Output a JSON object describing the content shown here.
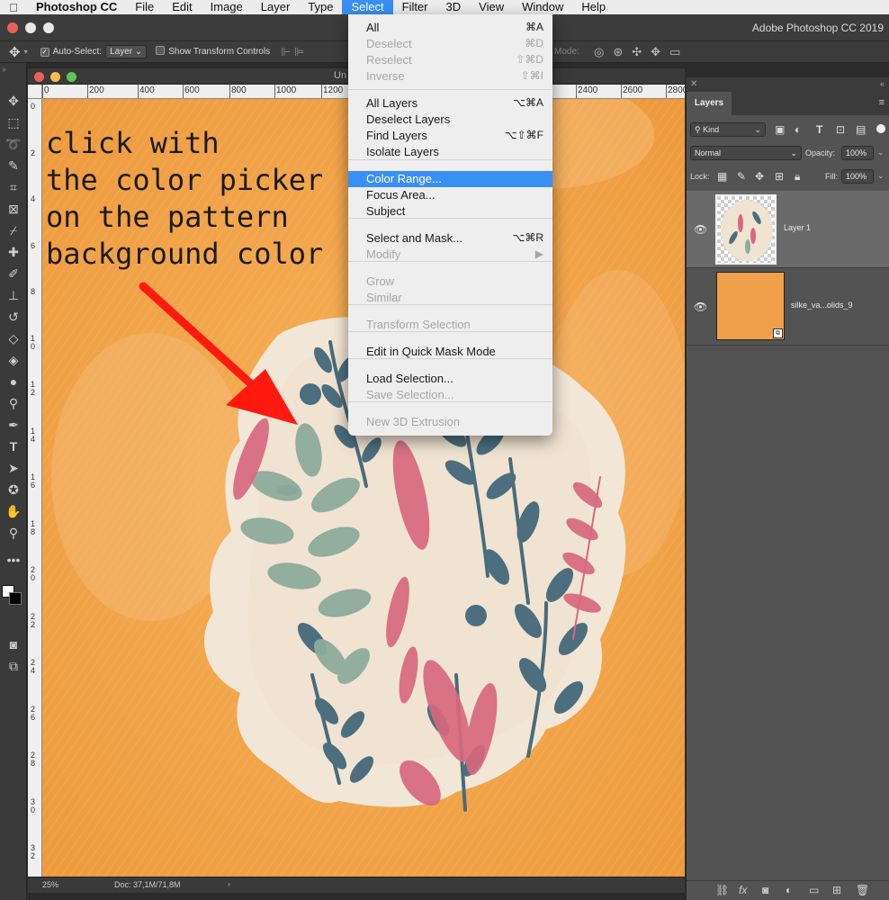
{
  "menubar": {
    "app_name": "Photoshop CC",
    "items": [
      "File",
      "Edit",
      "Image",
      "Layer",
      "Type",
      "Select",
      "Filter",
      "3D",
      "View",
      "Window",
      "Help"
    ],
    "active": "Select"
  },
  "titlebar": {
    "app_title": "Adobe Photoshop CC 2019"
  },
  "options": {
    "auto_select_label": "Auto-Select:",
    "auto_select_value": "Layer",
    "transform_label": "Show Transform Controls",
    "mode_label": "Mode:"
  },
  "document": {
    "title": "Un",
    "ruler_h": [
      "0",
      "200",
      "400",
      "600",
      "800",
      "1000",
      "1200",
      "2400",
      "2600",
      "2800"
    ],
    "ruler_v": [
      "0",
      "2",
      "4",
      "6",
      "8",
      "1 0",
      "1 2",
      "1 4",
      "1 6",
      "1 8",
      "2 0",
      "2 2",
      "2 4",
      "2 6",
      "2 8",
      "3 0",
      "3 2"
    ],
    "annotation_lines": [
      "click with",
      "the color picker",
      "on the pattern",
      "background color"
    ],
    "zoom": "25%",
    "doc_size": "Doc: 37,1M/71,8M"
  },
  "select_menu": {
    "items": [
      {
        "label": "All",
        "shortcut": "⌘A",
        "disabled": false
      },
      {
        "label": "Deselect",
        "shortcut": "⌘D",
        "disabled": true
      },
      {
        "label": "Reselect",
        "shortcut": "⇧⌘D",
        "disabled": true
      },
      {
        "label": "Inverse",
        "shortcut": "⇧⌘I",
        "disabled": true
      },
      {
        "label": "All Layers",
        "shortcut": "⌥⌘A",
        "disabled": false
      },
      {
        "label": "Deselect Layers",
        "shortcut": "",
        "disabled": false
      },
      {
        "label": "Find Layers",
        "shortcut": "⌥⇧⌘F",
        "disabled": false
      },
      {
        "label": "Isolate Layers",
        "shortcut": "",
        "disabled": false
      },
      {
        "label": "Color Range...",
        "shortcut": "",
        "disabled": false,
        "highlighted": true
      },
      {
        "label": "Focus Area...",
        "shortcut": "",
        "disabled": false
      },
      {
        "label": "Subject",
        "shortcut": "",
        "disabled": false
      },
      {
        "label": "Select and Mask...",
        "shortcut": "⌥⌘R",
        "disabled": false
      },
      {
        "label": "Modify",
        "shortcut": "▶",
        "disabled": true
      },
      {
        "label": "Grow",
        "shortcut": "",
        "disabled": true
      },
      {
        "label": "Similar",
        "shortcut": "",
        "disabled": true
      },
      {
        "label": "Transform Selection",
        "shortcut": "",
        "disabled": true
      },
      {
        "label": "Edit in Quick Mask Mode",
        "shortcut": "",
        "disabled": false
      },
      {
        "label": "Load Selection...",
        "shortcut": "",
        "disabled": false
      },
      {
        "label": "Save Selection...",
        "shortcut": "",
        "disabled": true
      },
      {
        "label": "New 3D Extrusion",
        "shortcut": "",
        "disabled": true
      }
    ]
  },
  "layers_panel": {
    "tab_label": "Layers",
    "kind_label": "Kind",
    "blend_mode": "Normal",
    "opacity_label": "Opacity:",
    "opacity_value": "100%",
    "lock_label": "Lock:",
    "fill_label": "Fill:",
    "fill_value": "100%",
    "layers": [
      {
        "name": "Layer 1",
        "selected": true
      },
      {
        "name": "silke_va...olids_9",
        "selected": false
      }
    ]
  },
  "colors": {
    "canvas_orange": "#f0a04a",
    "menu_highlight": "#3a8ff3",
    "arrow_red": "#ff1a10"
  }
}
